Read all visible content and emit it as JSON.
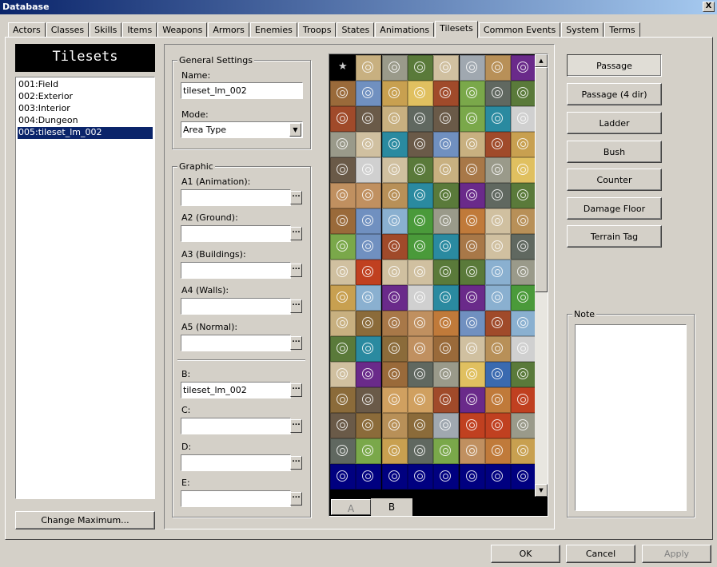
{
  "window": {
    "title": "Database",
    "close": "X"
  },
  "tabs": [
    "Actors",
    "Classes",
    "Skills",
    "Items",
    "Weapons",
    "Armors",
    "Enemies",
    "Troops",
    "States",
    "Animations",
    "Tilesets",
    "Common Events",
    "System",
    "Terms"
  ],
  "active_tab": "Tilesets",
  "list": {
    "header": "Tilesets",
    "items": [
      "001:Field",
      "002:Exterior",
      "003:Interior",
      "004:Dungeon",
      "005:tileset_lm_002"
    ],
    "selected": "005:tileset_lm_002",
    "change_max": "Change Maximum..."
  },
  "general": {
    "title": "General Settings",
    "name_label": "Name:",
    "name_value": "tileset_lm_002",
    "mode_label": "Mode:",
    "mode_value": "Area Type"
  },
  "graphic": {
    "title": "Graphic",
    "a1": "A1 (Animation):",
    "a2": "A2 (Ground):",
    "a3": "A3 (Buildings):",
    "a4": "A4 (Walls):",
    "a5": "A5 (Normal):",
    "b": "B:",
    "b_value": "tileset_lm_002",
    "c": "C:",
    "d": "D:",
    "e": "E:",
    "dots": "..."
  },
  "palette": {
    "tab_a": "A",
    "tab_b": "B"
  },
  "modes": [
    "Passage",
    "Passage (4 dir)",
    "Ladder",
    "Bush",
    "Counter",
    "Damage Floor",
    "Terrain Tag"
  ],
  "note": {
    "title": "Note"
  },
  "footer": {
    "ok": "OK",
    "cancel": "Cancel",
    "apply": "Apply"
  },
  "colors": {
    "title_start": "#0a246a",
    "title_end": "#a6caf0",
    "selection": "#0a246a",
    "face": "#d4d0c8"
  }
}
